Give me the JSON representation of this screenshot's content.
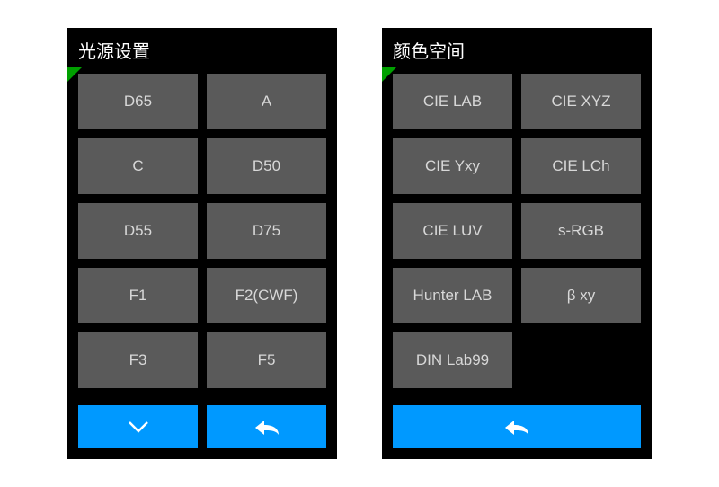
{
  "colors": {
    "accent": "#0099ff",
    "corner": "#00a000",
    "button_bg": "#5a5a5a",
    "button_fg": "#d8d8d8"
  },
  "panels": {
    "left": {
      "title": "光源设置",
      "options": [
        "D65",
        "A",
        "C",
        "D50",
        "D55",
        "D75",
        "F1",
        "F2(CWF)",
        "F3",
        "F5"
      ]
    },
    "right": {
      "title": "颜色空间",
      "options": [
        "CIE LAB",
        "CIE XYZ",
        "CIE Yxy",
        "CIE LCh",
        "CIE LUV",
        "s-RGB",
        "Hunter LAB",
        "β xy",
        "DIN Lab99"
      ]
    }
  },
  "icons": {
    "down": "chevron-down-icon",
    "back": "back-arrow-icon"
  }
}
